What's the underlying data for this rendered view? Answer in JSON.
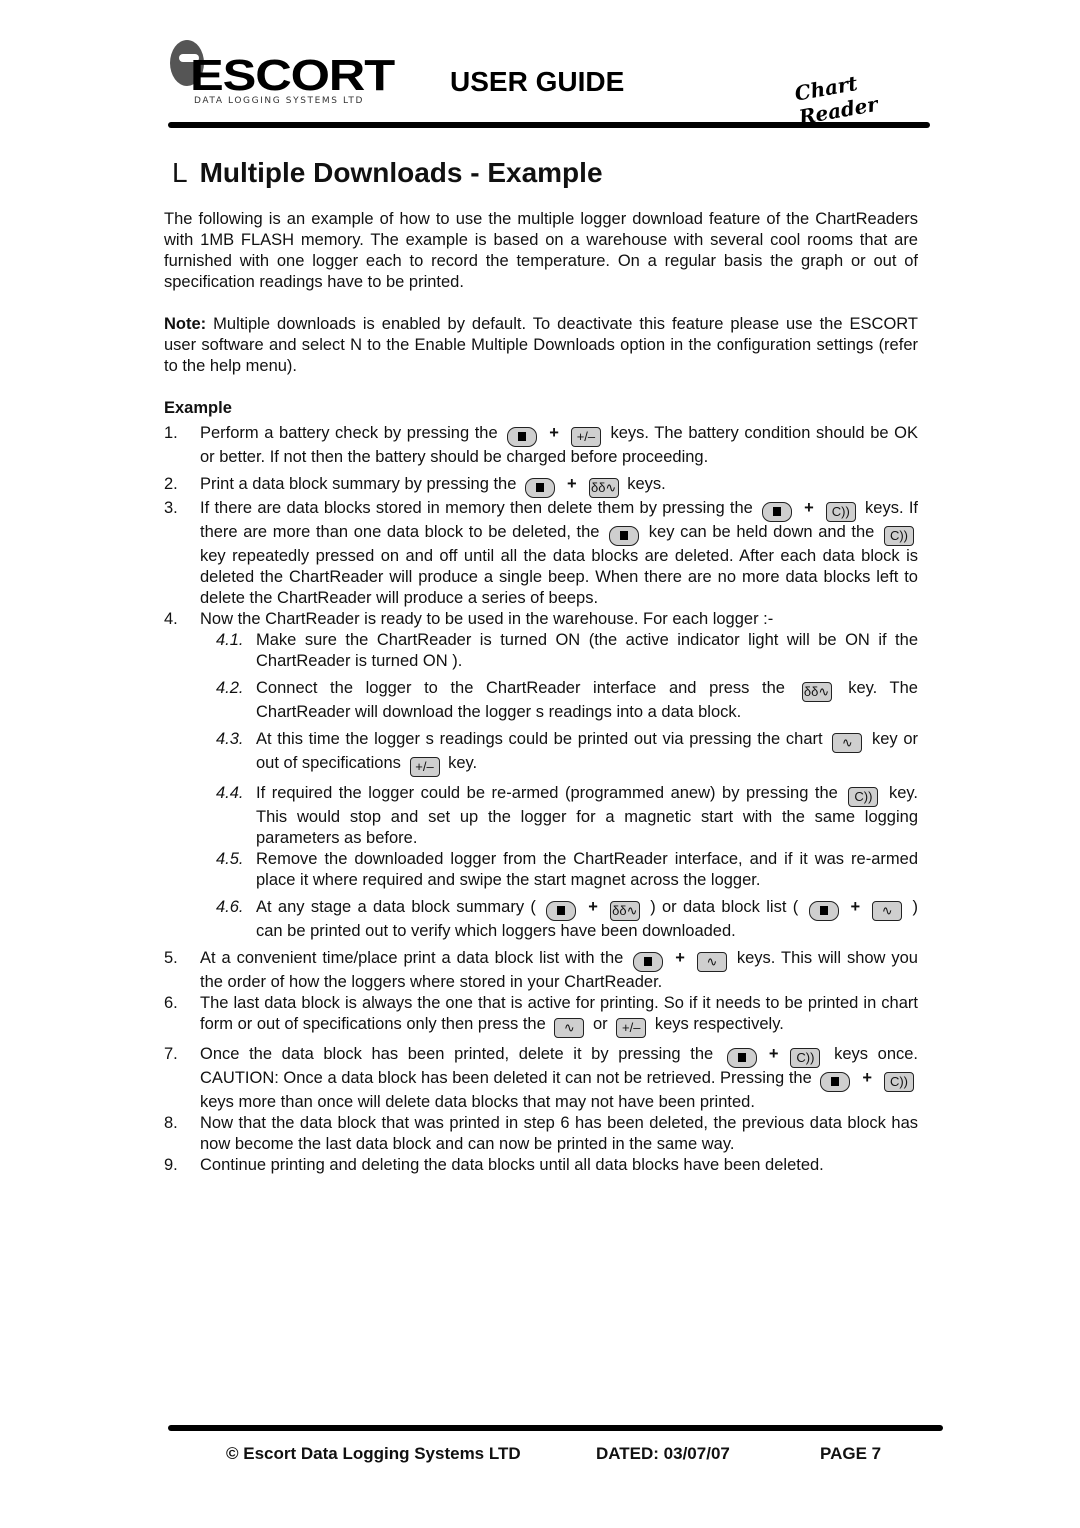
{
  "header": {
    "logo_word": "ESCORT",
    "logo_subtitle": "DATA LOGGING SYSTEMS LTD",
    "title": "USER GUIDE",
    "product": "Chart Reader"
  },
  "section": {
    "marker": "L",
    "title": "Multiple Downloads - Example",
    "intro": "The following is an example of how to use the multiple logger download feature of the ChartReaders with 1MB FLASH memory. The example is based on a warehouse with several cool rooms that are furnished with one logger each to record the temperature. On a regular basis the graph or out of specification readings have to be printed.",
    "note_label": "Note:",
    "note_text": " Multiple downloads is enabled by default. To deactivate this feature please use the ESCORT user software and select  N  to the  Enable Multiple Downloads  option in the configuration settings (refer to the help menu).",
    "example_heading": "Example"
  },
  "keys": {
    "stop": "stop-key",
    "plusminus": "+/–",
    "download": "δδ∿",
    "beep": "C))",
    "chart": "∿"
  },
  "steps": {
    "s1": {
      "num": "1.",
      "a": "Perform a battery check by pressing the",
      "b": "keys. The battery condition should be OK or better. If not then the battery should be charged before proceeding."
    },
    "s2": {
      "num": "2.",
      "a": "Print a data block summary by pressing the",
      "b": "keys."
    },
    "s3": {
      "num": "3.",
      "a": "If there are data blocks stored in memory then delete them by pressing the",
      "b": "keys. If there are more than one data block to be deleted, the",
      "c": "key can be held down and the",
      "d": "key repeatedly pressed on and off until all the data blocks are deleted. After each data block is deleted the ChartReader will produce a single beep. When there are no more data blocks left to delete the ChartReader will produce a series of beeps."
    },
    "s4": {
      "num": "4.",
      "a": "Now the ChartReader is ready to be used in the warehouse. For each logger :-"
    },
    "s4_1": {
      "num": "4.1.",
      "a": "Make sure the ChartReader is turned ON (the active indicator light will be ON if the ChartReader is turned ON )."
    },
    "s4_2": {
      "num": "4.2.",
      "a": "Connect the logger to the ChartReader interface and press the",
      "b": "key. The ChartReader will download the logger s readings into a data block."
    },
    "s4_3": {
      "num": "4.3.",
      "a": "At this time the logger s readings could be printed out via pressing the chart",
      "b": "key or out of specifications",
      "c": "key."
    },
    "s4_4": {
      "num": "4.4.",
      "a": "If required the logger could be re-armed (programmed anew) by pressing the",
      "b": "key. This would stop and set up the logger for a magnetic start with the same logging parameters as before."
    },
    "s4_5": {
      "num": "4.5.",
      "a": "Remove the downloaded logger from the ChartReader interface, and if it was re-armed place it where required and swipe the start magnet across the logger."
    },
    "s4_6": {
      "num": "4.6.",
      "a": "At any stage a data block summary (",
      "b": ") or data block list (",
      "c": ") can be printed out to verify which loggers have been downloaded."
    },
    "s5": {
      "num": "5.",
      "a": "At a convenient time/place print a data block list with the",
      "b": "keys. This will show you the order of how the loggers where stored in your ChartReader."
    },
    "s6": {
      "num": "6.",
      "a": "The last data block is always the one that is active for printing. So if it needs to be printed in chart form or out of specifications only then press the",
      "b": "or",
      "c": "keys respectively."
    },
    "s7": {
      "num": "7.",
      "a": "Once the data block has been printed, delete it by pressing the",
      "b": "keys once. CAUTION: Once a data block has been deleted it can not be retrieved. Pressing the",
      "c": "keys more than once will delete data blocks that may not have been printed."
    },
    "s8": {
      "num": "8.",
      "a": "Now that the data block that was printed in step 6 has been deleted, the previous data block has now become the last data block and can now be printed in the same way."
    },
    "s9": {
      "num": "9.",
      "a": "Continue printing and deleting the data blocks until all data blocks have been deleted."
    }
  },
  "plus": "+",
  "footer": {
    "copyright": "© Escort Data Logging Systems LTD",
    "dated": "DATED: 03/07/07",
    "page": "PAGE 7"
  }
}
